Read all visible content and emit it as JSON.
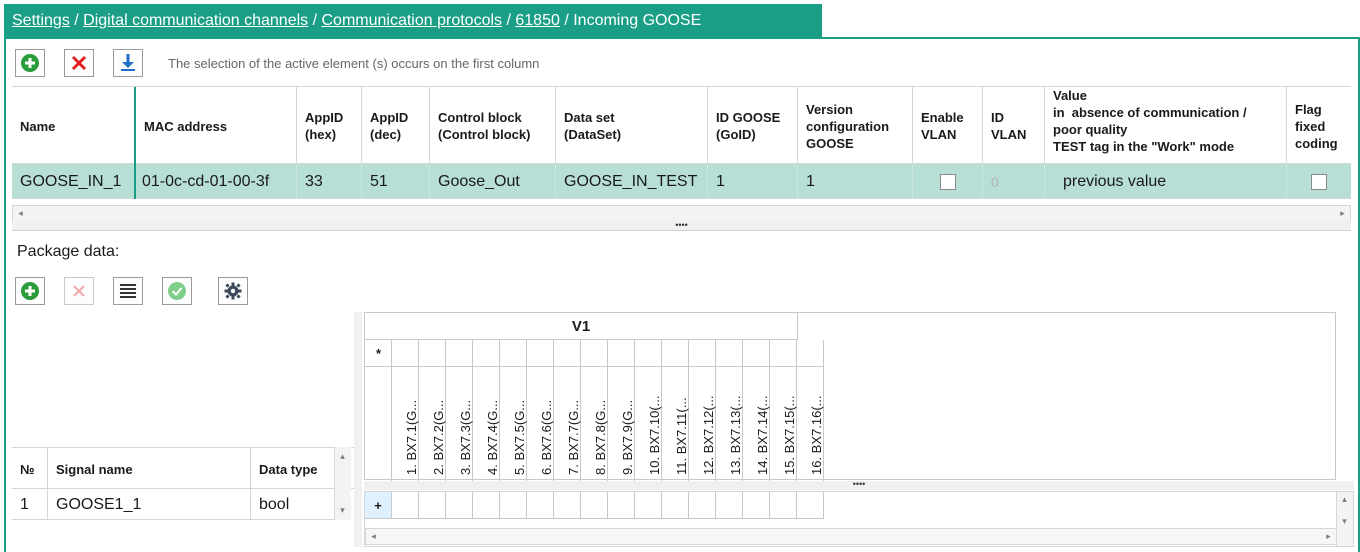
{
  "breadcrumb": {
    "items": [
      "Settings",
      "Digital communication channels",
      "Communication protocols",
      "61850"
    ],
    "separator": " / ",
    "current": "Incoming GOOSE"
  },
  "toolbar": {
    "add_icon": "plus-circle-icon",
    "delete_icon": "x-icon",
    "download_icon": "download-arrow-icon",
    "hint": "The selection of the active element (s) occurs on the first column"
  },
  "goose_table": {
    "headers": {
      "name": "Name",
      "mac": "MAC address",
      "appid_hex": [
        "AppID",
        "(hex)"
      ],
      "appid_dec": [
        "AppID",
        "(dec)"
      ],
      "control_block": [
        "Control block",
        "(Control block)"
      ],
      "data_set": [
        "Data set",
        "(DataSet)"
      ],
      "goid": [
        "ID GOOSE",
        "(GoID)"
      ],
      "version": [
        "Version",
        "configuration",
        "GOOSE"
      ],
      "enable_vlan": [
        "Enable",
        "VLAN"
      ],
      "id_vlan": [
        "ID",
        "VLAN"
      ],
      "value": [
        "Value",
        "in  absence of communication /",
        "poor quality",
        "TEST tag in the \"Work\" mode"
      ],
      "flag": [
        "Flag",
        "fixed",
        "coding"
      ]
    },
    "row": {
      "name": "GOOSE_IN_1",
      "mac": "01-0c-cd-01-00-3f",
      "appid_hex": "33",
      "appid_dec": "51",
      "control_block": "Goose_Out",
      "data_set": "GOOSE_IN_TEST",
      "goid": "1",
      "version": "1",
      "enable_vlan": false,
      "id_vlan": "0",
      "value": "previous value",
      "flag": false
    }
  },
  "package": {
    "label": "Package data:",
    "tools": [
      "plus-circle-icon",
      "x-icon",
      "list-icon",
      "check-circle-icon",
      "gear-icon"
    ]
  },
  "signals_table": {
    "headers": {
      "num": "№",
      "signal": "Signal name",
      "type": "Data type"
    },
    "rows": [
      {
        "num": "1",
        "signal": "GOOSE1_1",
        "type": "bool"
      }
    ]
  },
  "matrix": {
    "group": "V1",
    "star": "*",
    "columns": [
      "1. BX7.1(G...",
      "2. BX7.2(G...",
      "3. BX7.3(G...",
      "4. BX7.4(G...",
      "5. BX7.5(G...",
      "6. BX7.6(G...",
      "7. BX7.7(G...",
      "8. BX7.8(G...",
      "9. BX7.9(G...",
      "10. BX7.10(...",
      "11. BX7.11(...",
      "12. BX7.12(...",
      "13. BX7.13(...",
      "14. BX7.14(...",
      "15. BX7.15(...",
      "16. BX7.16(..."
    ],
    "add_row": "+"
  },
  "colors": {
    "accent": "#1a9f86",
    "selected_row": "#b7dfd6"
  }
}
